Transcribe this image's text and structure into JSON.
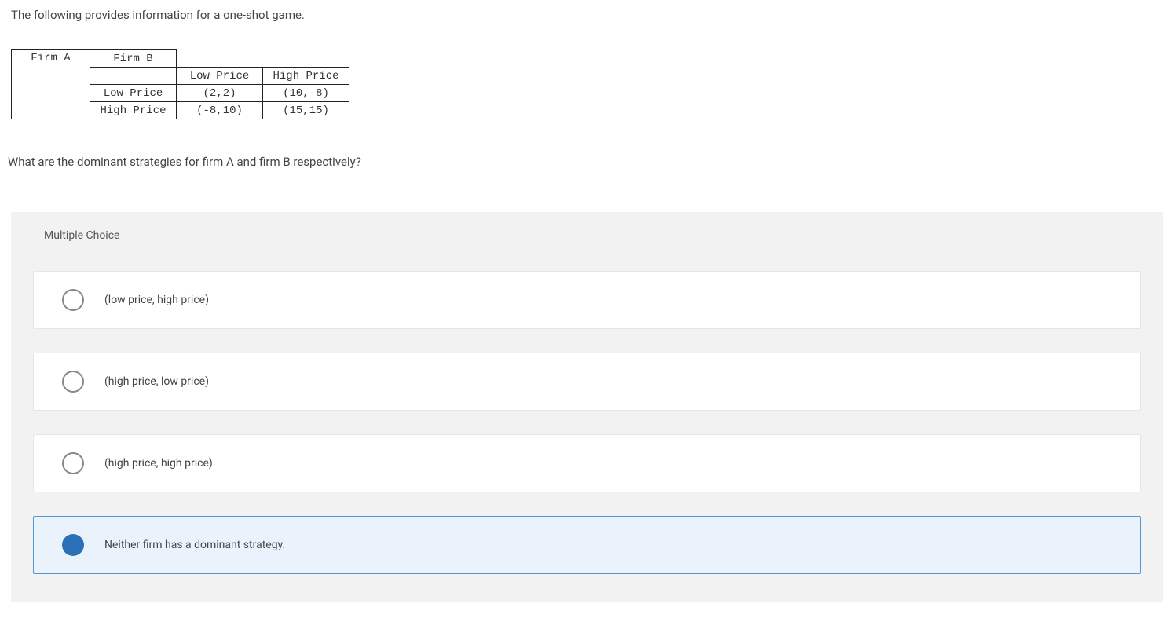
{
  "intro": "The following provides information for a one-shot game.",
  "table": {
    "firmA": "Firm A",
    "firmB": "Firm B",
    "colHeaders": {
      "low": "Low Price",
      "high": "High Price"
    },
    "rowHeaders": {
      "low": "Low Price",
      "high": "High Price"
    },
    "cells": {
      "ll": "(2,2)",
      "lh": "(10,-8)",
      "hl": "(-8,10)",
      "hh": "(15,15)"
    }
  },
  "question": "What are the dominant strategies for firm A and firm B respectively?",
  "mcHeader": "Multiple Choice",
  "options": {
    "a": "(low price, high price)",
    "b": "(high price, low price)",
    "c": "(high price, high price)",
    "d": "Neither firm has a dominant strategy."
  },
  "chart_data": {
    "type": "table",
    "title": "One-shot game payoff matrix",
    "row_player": "Firm A",
    "col_player": "Firm B",
    "row_strategies": [
      "Low Price",
      "High Price"
    ],
    "col_strategies": [
      "Low Price",
      "High Price"
    ],
    "payoffs": [
      [
        [
          2,
          2
        ],
        [
          10,
          -8
        ]
      ],
      [
        [
          -8,
          10
        ],
        [
          15,
          15
        ]
      ]
    ]
  }
}
